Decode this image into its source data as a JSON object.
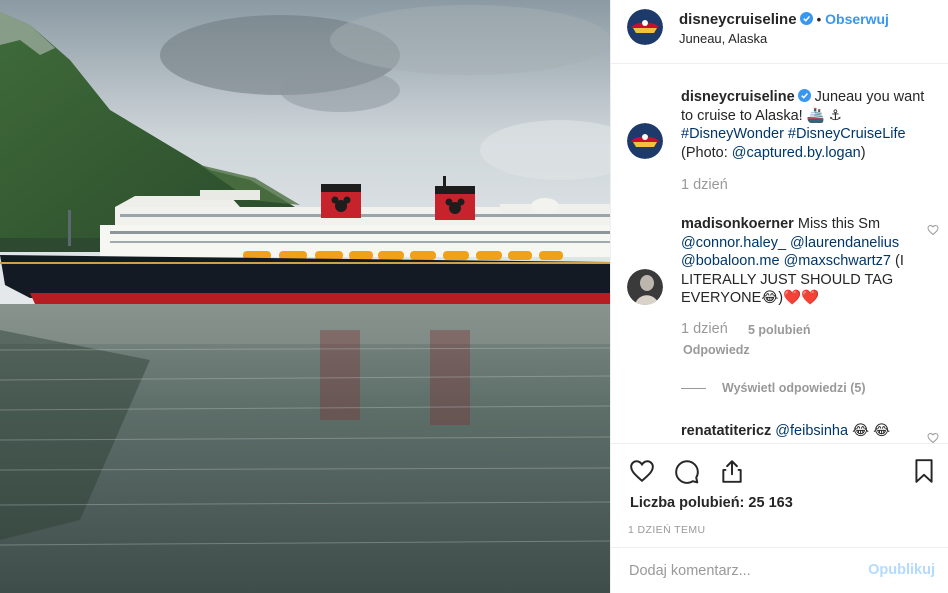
{
  "post": {
    "username": "disneycruiseline",
    "follow_label": "Obserwuj",
    "location": "Juneau, Alaska"
  },
  "caption": {
    "username": "disneycruiseline",
    "text": "Juneau you want to cruise to Alaska! 🚢 ⚓",
    "hashtags": "#DisneyWonder #DisneyCruiseLife",
    "photo_prefix": "(Photo: ",
    "photo_credit": "@captured.by.logan",
    "photo_suffix": ")",
    "age": "1 dzień"
  },
  "comments": [
    {
      "username": "madisonkoerner",
      "text_prefix": "Miss this Sm",
      "mentions_1": "@connor.haley_ @laurendanelius",
      "mentions_2": "@bobaloon.me @maxschwartz7",
      "text_suffix": "(I LITERALLY JUST SHOULD TAG EVERYONE😂)❤️❤️",
      "age": "1 dzień",
      "likes": "5 polubień",
      "reply_label": "Odpowiedz",
      "view_replies": "Wyświetl odpowiedzi (5)"
    },
    {
      "username": "renatatitericz",
      "mention": "@feibsinha",
      "text_suffix": "😂 😂"
    }
  ],
  "actions": {
    "likes_label": "Liczba polubień: 25 163",
    "timestamp": "1 DZIEŃ TEMU"
  },
  "add_comment": {
    "placeholder": "Dodaj komentarz...",
    "publish_label": "Opublikuj"
  },
  "colors": {
    "link_blue": "#3897f0",
    "mention_blue": "#00376b",
    "muted": "#999999",
    "publish_disabled": "#b3dbff"
  },
  "icons": [
    "verified-badge-icon",
    "heart-icon",
    "comment-icon",
    "share-icon",
    "bookmark-icon",
    "small-heart-icon"
  ]
}
